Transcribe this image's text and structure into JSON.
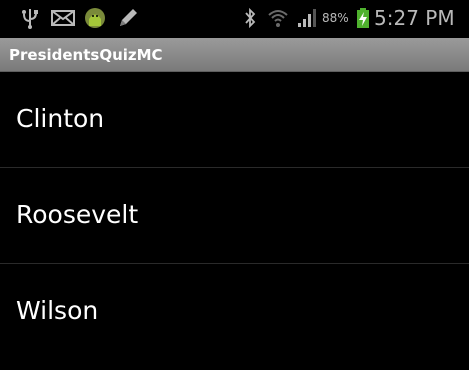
{
  "status_bar": {
    "icons": [
      "usb-icon",
      "mail-icon",
      "android-icon",
      "pen-icon",
      "bluetooth-icon",
      "wifi-icon",
      "signal-icon",
      "battery-charging-icon"
    ],
    "battery_percent": "88%",
    "time": "5:27 PM",
    "colors": {
      "icon": "#b9b9b9",
      "battery_green": "#4fb22e"
    }
  },
  "app_bar": {
    "title": "PresidentsQuizMC"
  },
  "list": {
    "items": [
      {
        "label": "Clinton"
      },
      {
        "label": "Roosevelt"
      },
      {
        "label": "Wilson"
      }
    ]
  }
}
